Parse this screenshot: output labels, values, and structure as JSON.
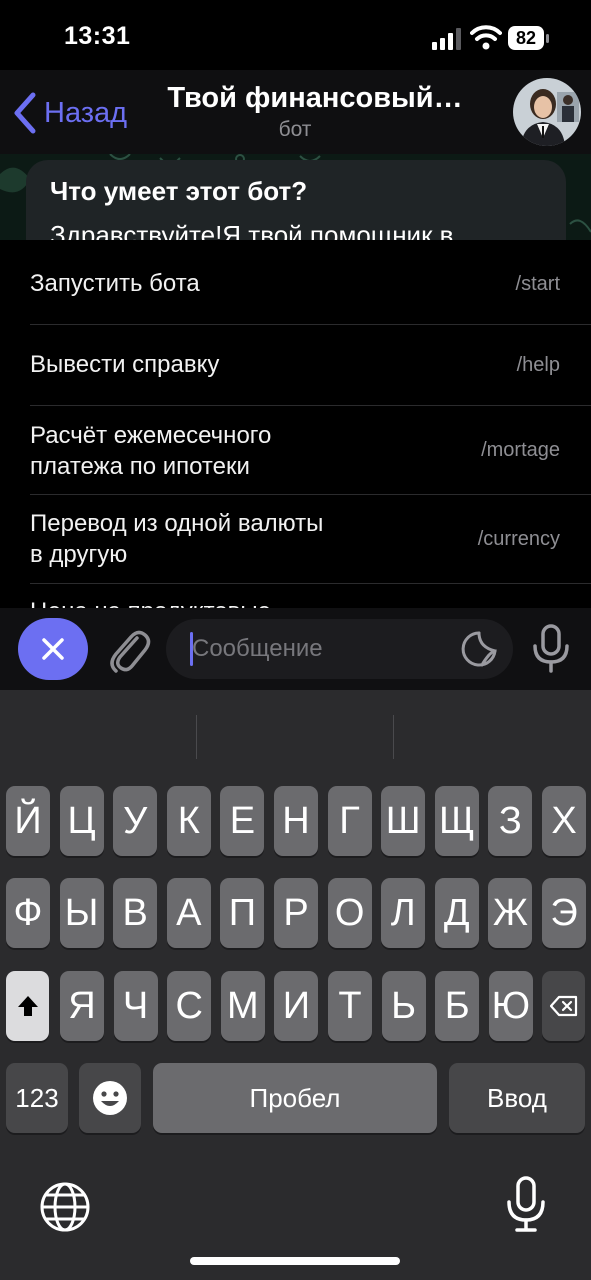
{
  "status_bar": {
    "time": "13:31",
    "battery": "82"
  },
  "header": {
    "back_label": "Назад",
    "title": "Твой финансовый…",
    "subtitle": "бот"
  },
  "intro": {
    "title": "Что умеет этот бот?",
    "text": "Здравствуйте!Я твой помощник в"
  },
  "commands": [
    {
      "description": "Запустить бота",
      "command": "/start"
    },
    {
      "description": "Вывести справку",
      "command": "/help"
    },
    {
      "description": "Расчёт ежемесечного платежа по ипотеки",
      "command": "/mortage"
    },
    {
      "description": "Перевод из одной валюты в другую",
      "command": "/currency"
    },
    {
      "description": "Цена на продуктовые",
      "command": ""
    }
  ],
  "input": {
    "placeholder": "Сообщение"
  },
  "keyboard": {
    "row1": [
      "Й",
      "Ц",
      "У",
      "К",
      "Е",
      "Н",
      "Г",
      "Ш",
      "Щ",
      "З",
      "Х"
    ],
    "row2": [
      "Ф",
      "Ы",
      "В",
      "А",
      "П",
      "Р",
      "О",
      "Л",
      "Д",
      "Ж",
      "Э"
    ],
    "row3": [
      "Я",
      "Ч",
      "С",
      "М",
      "И",
      "Т",
      "Ь",
      "Б",
      "Ю"
    ],
    "numbers_label": "123",
    "space_label": "Пробел",
    "return_label": "Ввод"
  },
  "colors": {
    "accent": "#6c6ff2",
    "keyboard_bg": "#2b2b2d",
    "key": "#6b6b6e"
  }
}
